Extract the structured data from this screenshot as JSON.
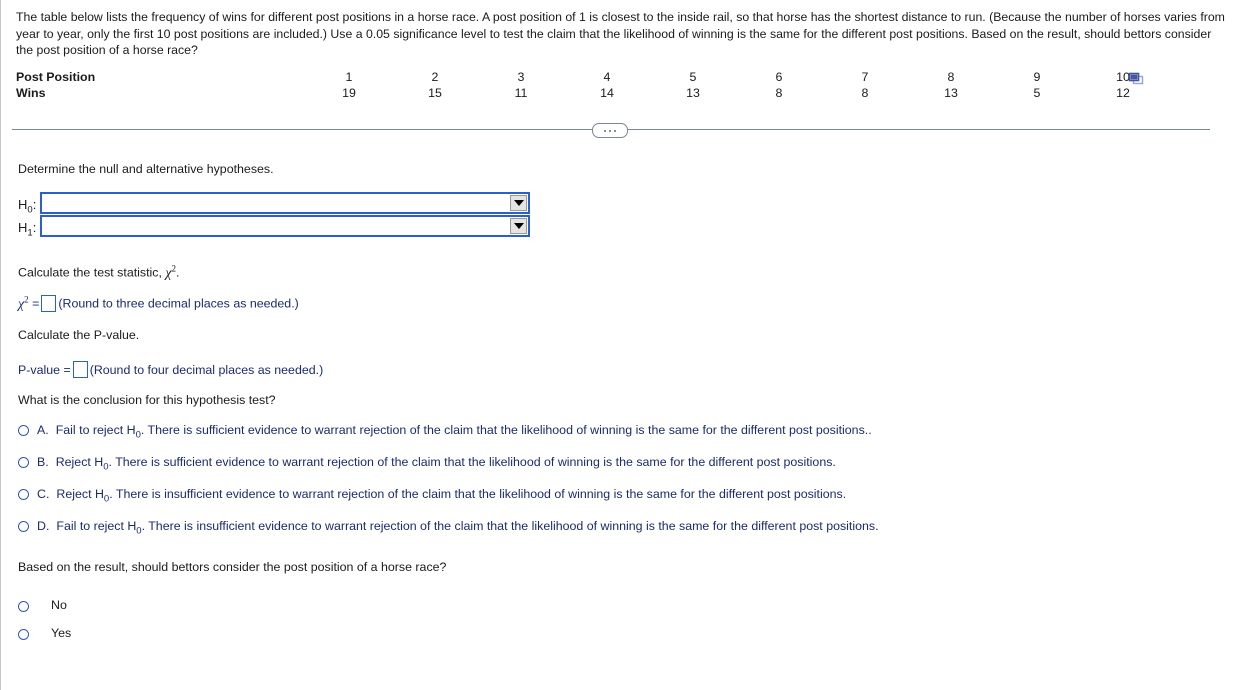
{
  "problem": {
    "statement": "The table below lists the frequency of wins for different post positions in a horse race. A post position of 1 is closest to the inside rail, so that horse has the shortest distance to run. (Because the number of horses varies from year to year, only the first 10 post positions are included.) Use a 0.05 significance level to test the claim that the likelihood of winning is the same for the different post positions. Based on the result, should bettors consider the post position of a horse race?"
  },
  "table": {
    "row_labels": [
      "Post Position",
      "Wins"
    ],
    "positions": [
      "1",
      "2",
      "3",
      "4",
      "5",
      "6",
      "7",
      "8",
      "9",
      "10"
    ],
    "wins": [
      "19",
      "15",
      "11",
      "14",
      "13",
      "8",
      "8",
      "13",
      "5",
      "12"
    ],
    "popout_icon": "popout-window-icon"
  },
  "splitter": {
    "handle_icon": "three-dots-handle"
  },
  "hypotheses": {
    "prompt": "Determine the null and alternative hypotheses.",
    "null_label": "H",
    "null_sub": "0",
    "alt_label": "H",
    "alt_sub": "1",
    "colon": ":",
    "null_value": "",
    "alt_value": "",
    "arrow_icon": "chevron-down-icon"
  },
  "test_statistic": {
    "prompt_prefix": "Calculate the test statistic, ",
    "prompt_symbol": "χ",
    "prompt_sup": "2",
    "prompt_suffix": ".",
    "equals": "=",
    "value": "",
    "hint": "(Round to three decimal places as needed.)"
  },
  "p_value": {
    "prompt": "Calculate the P-value.",
    "label": "P-value =",
    "value": "",
    "hint": "(Round to four decimal places as needed.)"
  },
  "conclusion": {
    "prompt": "What is the conclusion for this hypothesis test?",
    "options": [
      {
        "letter": "A.",
        "lead": "Fail to reject H",
        "sub": "0",
        "rest": ". There is sufficient evidence to warrant rejection of the claim that the likelihood of winning is the same for the different post positions.."
      },
      {
        "letter": "B.",
        "lead": "Reject H",
        "sub": "0",
        "rest": ". There is sufficient evidence to warrant rejection of the claim that the likelihood of winning is the same for the different post positions."
      },
      {
        "letter": "C.",
        "lead": "Reject H",
        "sub": "0",
        "rest": ". There is insufficient evidence to warrant rejection of the claim that the likelihood of winning is the same for the different post positions."
      },
      {
        "letter": "D.",
        "lead": "Fail to reject H",
        "sub": "0",
        "rest": ". There is insufficient evidence to warrant rejection of the claim that the likelihood of winning is the same for the different post positions."
      }
    ]
  },
  "final_question": {
    "prompt": "Based on the result, should bettors consider the post position of a horse race?",
    "options": [
      "No",
      "Yes"
    ]
  },
  "colors": {
    "answer_text": "#1b2b6b",
    "body_text": "#1b1b1b",
    "input_border": "#2a5fcc",
    "divider": "#7a8699"
  }
}
